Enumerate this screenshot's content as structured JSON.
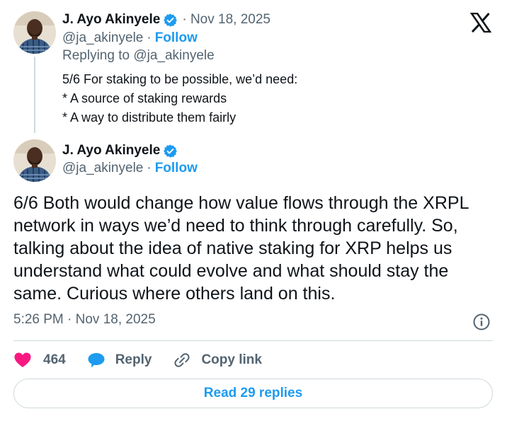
{
  "parent": {
    "display_name": "J. Ayo Akinyele",
    "date": "· Nov 18, 2025",
    "handle": "@ja_akinyele",
    "separator": "·",
    "follow": "Follow",
    "replying_to": "Replying to @ja_akinyele",
    "lines": [
      "5/6 For staking to be possible, we’d need:",
      "* A source of staking rewards",
      "* A way to distribute them fairly"
    ]
  },
  "main": {
    "display_name": "J. Ayo Akinyele",
    "handle": "@ja_akinyele",
    "separator": "·",
    "follow": "Follow",
    "text": "6/6 Both would change how value flows through the XRPL network in ways we’d need to think through carefully. So, talking about the idea of native staking for XRP helps us understand what could evolve and what should stay the same. Curious where others land on this.",
    "timestamp": "5:26 PM · Nov 18, 2025"
  },
  "actions": {
    "like_count": "464",
    "reply_label": "Reply",
    "copy_label": "Copy link"
  },
  "read_replies": "Read 29 replies",
  "colors": {
    "accent": "#1d9bf0",
    "like": "#f91880",
    "muted": "#536471",
    "text": "#0f1419",
    "border": "#cfd9de"
  },
  "icons": {
    "verified": "verified-badge-icon",
    "brand": "x-logo-icon",
    "info": "info-icon",
    "like": "heart-icon",
    "reply": "speech-bubble-icon",
    "copy": "link-icon"
  }
}
